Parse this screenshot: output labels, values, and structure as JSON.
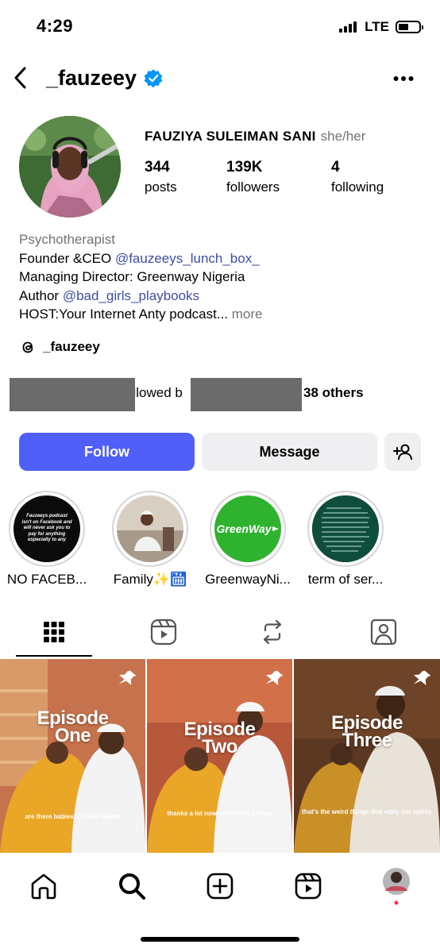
{
  "status_bar": {
    "time": "4:29",
    "network": "LTE"
  },
  "header": {
    "username": "_fauzeey",
    "verified": true
  },
  "profile": {
    "full_name": "FAUZIYA SULEIMAN SANI",
    "pronouns": "she/her",
    "stats": [
      {
        "value": "344",
        "label": "posts"
      },
      {
        "value": "139K",
        "label": "followers"
      },
      {
        "value": "4",
        "label": "following"
      }
    ],
    "bio": {
      "category": "Psychotherapist",
      "line1_prefix": "Founder &CEO ",
      "line1_link": "@fauzeeys_lunch_box_",
      "line2": "Managing Director: Greenway Nigeria",
      "line3_prefix": "Author ",
      "line3_link": "@bad_girls_playbooks",
      "line4": "HOST:Your Internet Anty podcast...",
      "more": "more"
    },
    "threads_handle": "_fauzeey",
    "followed_by_text": "ollowed b",
    "followed_by_others": "38 others"
  },
  "actions": {
    "follow": "Follow",
    "message": "Message"
  },
  "highlights": [
    {
      "label": "NO FACEB...",
      "cover_text": "Fauzeeys podcast isn't on Facebook and will never ask you to pay for anything especially to any"
    },
    {
      "label": "Family✨🛗"
    },
    {
      "label": "GreenwayNi...",
      "cover_text": "GreenWay"
    },
    {
      "label": "term of ser..."
    }
  ],
  "posts": [
    {
      "title_line1": "Episode",
      "title_line2": "One",
      "caption": "are there babies in there maybe",
      "pinned": true
    },
    {
      "title_line1": "Episode",
      "title_line2": "Two",
      "caption": "thanks a lot now everybody knows",
      "pinned": true
    },
    {
      "title_line1": "Episode",
      "title_line2": "Three",
      "caption": "that's the weird things that edify our spirits",
      "pinned": true
    }
  ],
  "colors": {
    "follow_button": "#4f5ff7",
    "link": "#3e4ea3",
    "verified": "#0095f6"
  }
}
